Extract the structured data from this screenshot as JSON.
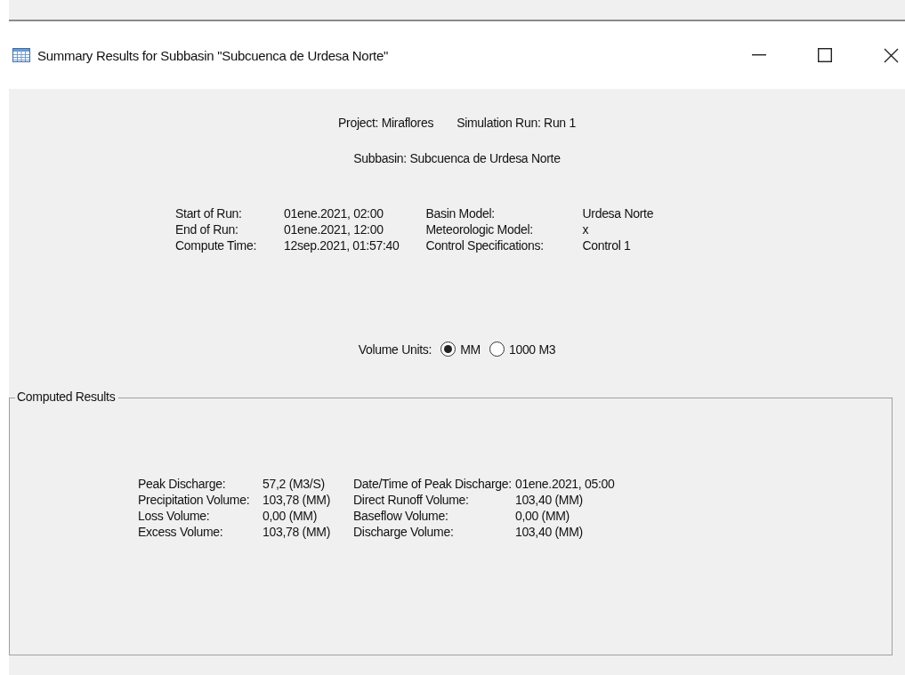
{
  "window": {
    "title": "Summary Results for Subbasin \"Subcuenca de Urdesa Norte\""
  },
  "header": {
    "project": "Project: Miraflores",
    "simulation_run": "Simulation Run: Run 1",
    "subbasin": "Subbasin: Subcuenca de Urdesa Norte"
  },
  "run_info": {
    "left": [
      {
        "label": "Start of Run:",
        "value": "01ene.2021, 02:00"
      },
      {
        "label": "End of Run:",
        "value": "01ene.2021, 12:00"
      },
      {
        "label": "Compute Time:",
        "value": "12sep.2021, 01:57:40"
      }
    ],
    "right": [
      {
        "label": "Basin Model:",
        "value": "Urdesa Norte"
      },
      {
        "label": "Meteorologic Model:",
        "value": "x"
      },
      {
        "label": "Control Specifications:",
        "value": "Control 1"
      }
    ]
  },
  "volume_units": {
    "label": "Volume Units:",
    "options": [
      {
        "label": "MM",
        "selected": true
      },
      {
        "label": "1000 M3",
        "selected": false
      }
    ]
  },
  "computed_results": {
    "title": "Computed Results",
    "left": [
      {
        "label": "Peak Discharge:",
        "value": "57,2 (M3/S)"
      },
      {
        "label": "Precipitation Volume:",
        "value": "103,78 (MM)"
      },
      {
        "label": "Loss Volume:",
        "value": "0,00 (MM)"
      },
      {
        "label": "Excess Volume:",
        "value": "103,78 (MM)"
      }
    ],
    "right": [
      {
        "label": "Date/Time of Peak Discharge:",
        "value": "01ene.2021, 05:00"
      },
      {
        "label": "Direct Runoff Volume:",
        "value": "103,40 (MM)"
      },
      {
        "label": "Baseflow Volume:",
        "value": "0,00 (MM)"
      },
      {
        "label": "Discharge Volume:",
        "value": "103,40 (MM)"
      }
    ]
  }
}
